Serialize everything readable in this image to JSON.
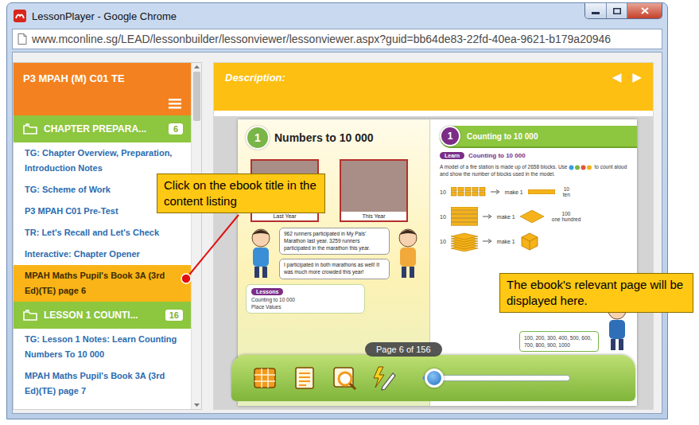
{
  "window": {
    "title": "LessonPlayer - Google Chrome",
    "url": "www.mconline.sg/LEAD/lessonbuilder/lessonviewer/lessonviewer.aspx?guid=bb64de83-22fd-40ea-9621-b179a20946"
  },
  "sidebar": {
    "title": "P3 MPAH (M) C01 TE",
    "sections": [
      {
        "title": "CHAPTER PREPARA...",
        "count": "6",
        "items": [
          {
            "label": "TG: Chapter Overview, Preparation, Introduction Notes",
            "selected": false
          },
          {
            "label": "TG: Scheme of Work",
            "selected": false
          },
          {
            "label": "P3 MPAH C01 Pre-Test",
            "selected": false
          },
          {
            "label": "TR: Let's Recall and Let's Check",
            "selected": false
          },
          {
            "label": "Interactive: Chapter Opener",
            "selected": false
          },
          {
            "label": "MPAH Maths Pupil's Book 3A (3rd Ed)(TE) page 6",
            "selected": true
          }
        ]
      },
      {
        "title": "LESSON 1 COUNTI...",
        "count": "16",
        "items": [
          {
            "label": "TG: Lesson 1 Notes: Learn Counting Numbers To 10 000",
            "selected": false
          },
          {
            "label": "MPAH Maths Pupil's Book 3A (3rd Ed)(TE) page 7",
            "selected": false
          }
        ]
      }
    ]
  },
  "description": {
    "label": "Description:",
    "prev": "◀",
    "next": "▶"
  },
  "ebook": {
    "left_page": {
      "chapter_number": "1",
      "title": "Numbers to 10 000",
      "photos": [
        {
          "caption": "Last Year"
        },
        {
          "caption": "This Year"
        }
      ],
      "bubbles": [
        "962 runners participated in My Pals' Marathon last year. 3259 runners participated in the marathon this year.",
        "I participated in both marathons as well! It was much more crowded this year!"
      ],
      "lessons_label": "Lessons",
      "lessons": [
        "Counting to 10 000",
        "Place Values"
      ]
    },
    "right_page": {
      "lesson_number": "1",
      "title": "Counting to 10 000",
      "learn_tag": "Learn",
      "subtitle": "Counting to 10 000",
      "intro": "A model of a fire station is made up of 2658 blocks.",
      "use_before": "Use",
      "use_after": "to count aloud and show the number of blocks used in the model.",
      "rows": [
        {
          "kind": "ones",
          "count": "10",
          "make": "make 1",
          "value": "10",
          "word": "ten"
        },
        {
          "kind": "tens",
          "count": "10",
          "make": "make 1",
          "value": "100",
          "word": "one hundred"
        },
        {
          "kind": "hundreds",
          "count": "10",
          "make": "make 1"
        }
      ],
      "sequence": "100, 200, 300, 400, 500, 600, 700, 800, 900, 1000"
    },
    "page_indicator": "Page 6 of 156",
    "slider": {
      "level": 0.08
    }
  },
  "callouts": [
    {
      "text": "Click on the ebook title in the content listing"
    },
    {
      "text": "The ebook's relevant page will be displayed here."
    }
  ]
}
